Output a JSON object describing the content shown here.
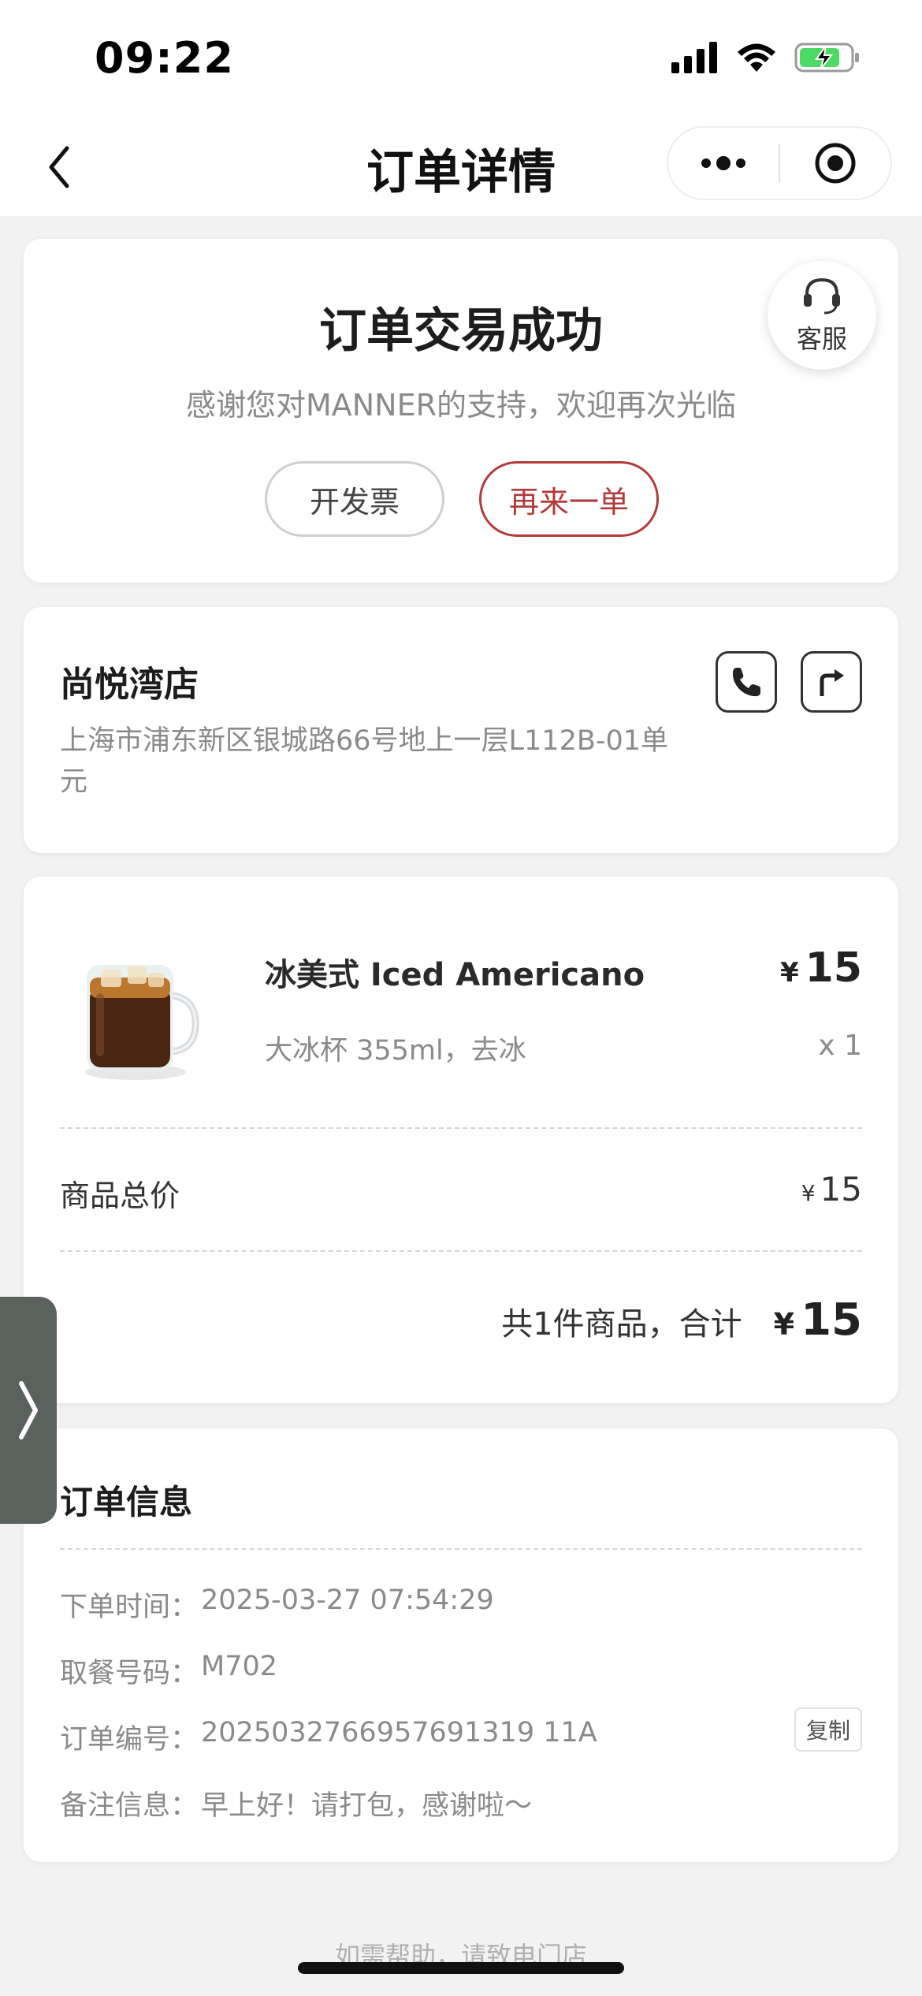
{
  "status_bar": {
    "time": "09:22"
  },
  "nav": {
    "title": "订单详情"
  },
  "success": {
    "title": "订单交易成功",
    "subtitle": "感谢您对MANNER的支持，欢迎再次光临",
    "invoice_button": "开发票",
    "reorder_button": "再来一单",
    "customer_service": "客服"
  },
  "store": {
    "name": "尚悦湾店",
    "address": "上海市浦东新区银城路66号地上一层L112B-01单元"
  },
  "goods": {
    "currency": "¥",
    "items": [
      {
        "name": "冰美式 Iced Americano",
        "spec": "大冰杯 355ml，去冰",
        "price": "15",
        "qty": "x 1"
      }
    ],
    "subtotal_label": "商品总价",
    "subtotal": "15",
    "total_label": "共1件商品，合计",
    "total": "15"
  },
  "order_info": {
    "title": "订单信息",
    "order_time_label": "下单时间：",
    "order_time": "2025-03-27 07:54:29",
    "pickup_label": "取餐号码：",
    "pickup_code": "M702",
    "order_no_label": "订单编号：",
    "order_no": "2025032766957691319 11A",
    "copy_button": "复制",
    "remark_label": "备注信息：",
    "remark": "早上好！请打包，感谢啦～"
  },
  "footer": {
    "help_text": "如需帮助，请致电门店"
  },
  "colors": {
    "accent": "#b23a3a",
    "side_tab": "#5b625d"
  }
}
